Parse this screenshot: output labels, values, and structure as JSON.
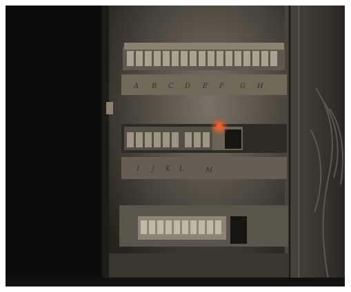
{
  "scene": {
    "description_free": true,
    "row1_labels": [
      "A",
      "B",
      "C",
      "D",
      "E",
      "F",
      "G",
      "H"
    ],
    "row2_labels": [
      "I",
      "J",
      "K",
      "L",
      "M"
    ],
    "indicator_color": "#ff5a2a",
    "panel_color": "#6d665a",
    "door_color": "#0c0c0b"
  }
}
